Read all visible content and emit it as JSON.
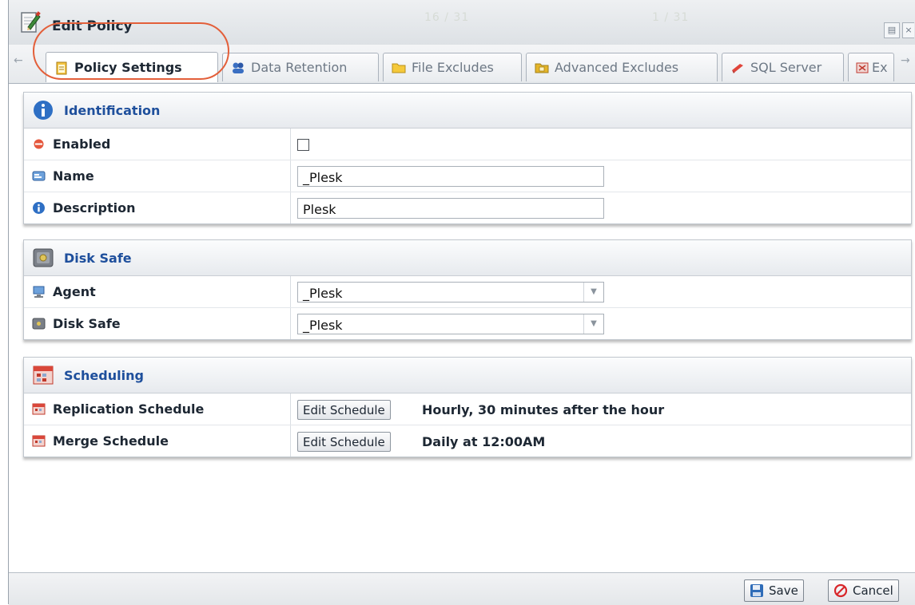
{
  "window": {
    "title": "Edit Policy",
    "background_ghost": [
      "16 / 31",
      "1 / 31"
    ]
  },
  "tabs": [
    {
      "label": "Policy Settings",
      "icon": "document-icon",
      "active": true
    },
    {
      "label": "Data Retention",
      "icon": "users-icon",
      "active": false
    },
    {
      "label": "File Excludes",
      "icon": "folder-icon",
      "active": false
    },
    {
      "label": "Advanced Excludes",
      "icon": "folder-advanced-icon",
      "active": false
    },
    {
      "label": "SQL Server",
      "icon": "sql-server-icon",
      "active": false
    },
    {
      "label": "Ex",
      "icon": "exchange-icon",
      "active": false
    }
  ],
  "identification": {
    "header": "Identification",
    "enabled_label": "Enabled",
    "enabled_checked": false,
    "name_label": "Name",
    "name_value": "_Plesk",
    "description_label": "Description",
    "description_value": "Plesk"
  },
  "disk_safe": {
    "header": "Disk Safe",
    "agent_label": "Agent",
    "agent_value": "_Plesk",
    "disk_safe_label": "Disk Safe",
    "disk_safe_value": "_Plesk"
  },
  "scheduling": {
    "header": "Scheduling",
    "replication_label": "Replication Schedule",
    "replication_button": "Edit Schedule",
    "replication_value": "Hourly, 30 minutes after the hour",
    "merge_label": "Merge Schedule",
    "merge_button": "Edit Schedule",
    "merge_value": "Daily at 12:00AM"
  },
  "footer": {
    "save_label": "Save",
    "cancel_label": "Cancel"
  },
  "colors": {
    "accent_header": "#1e4f9c",
    "highlight_ring": "#e35f3a",
    "cancel_red": "#d8262a",
    "save_blue": "#2f6cb8"
  }
}
